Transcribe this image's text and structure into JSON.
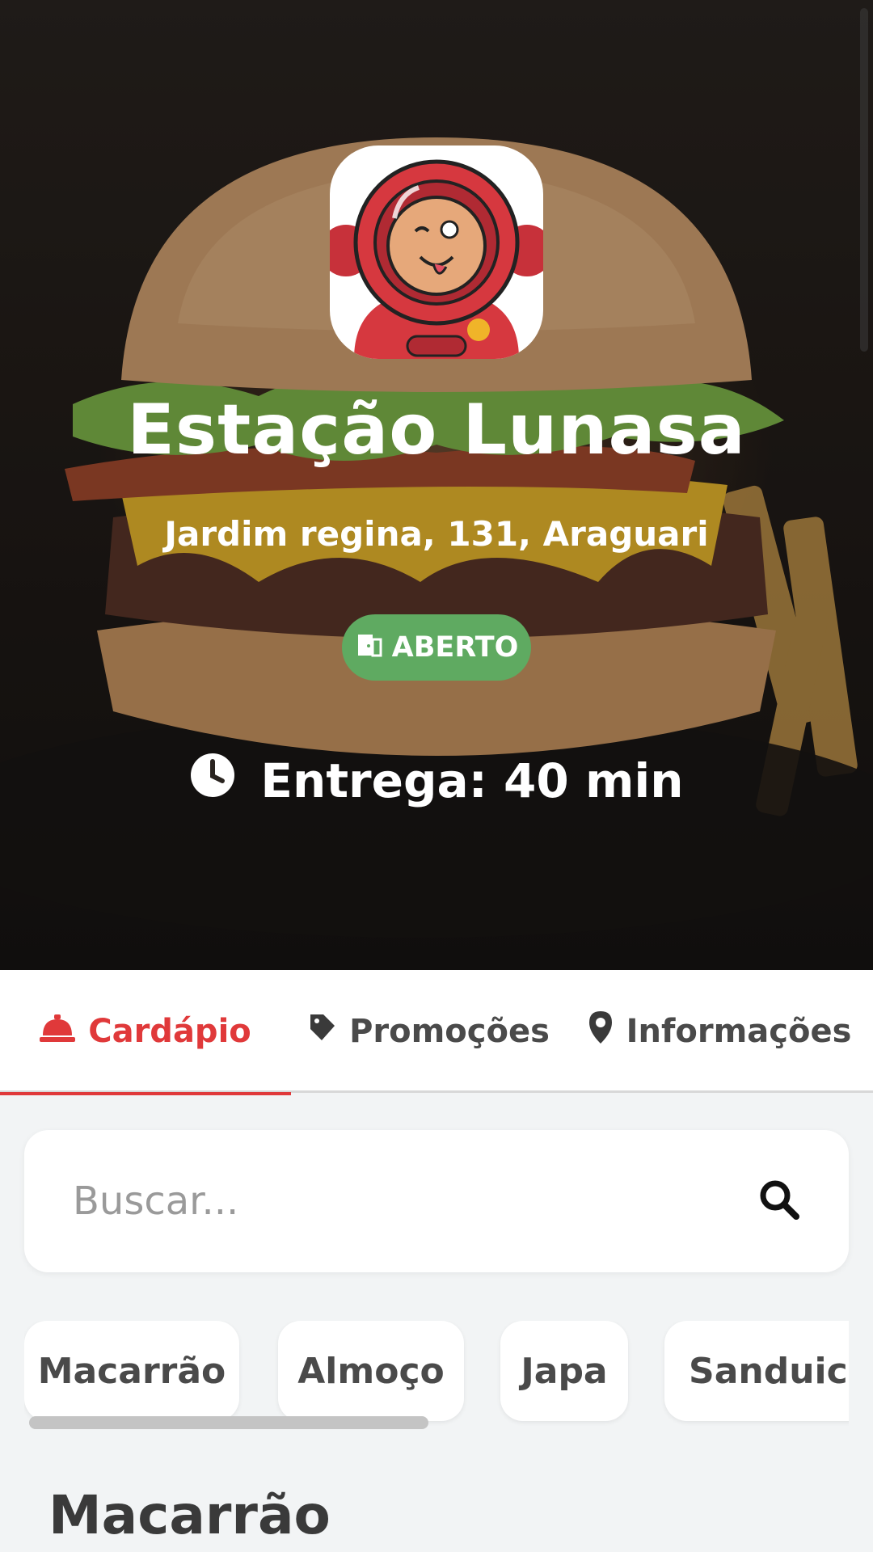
{
  "store": {
    "name": "Estação Lunasa",
    "address": "Jardim regina, 131, Araguari",
    "status": "ABERTO",
    "delivery": "Entrega: 40 min",
    "status_color": "#5faa61"
  },
  "tabs": [
    {
      "label": "Cardápio",
      "icon": "bell-service-icon",
      "active": true
    },
    {
      "label": "Promoções",
      "icon": "tag-icon",
      "active": false
    },
    {
      "label": "Informações",
      "icon": "map-pin-icon",
      "active": false
    }
  ],
  "search": {
    "placeholder": "Buscar..."
  },
  "categories": [
    "Macarrão",
    "Almoço",
    "Japa",
    "Sanduich"
  ],
  "section": {
    "title": "Macarrão"
  },
  "colors": {
    "accent": "#e0393a",
    "background": "#f2f4f5"
  }
}
